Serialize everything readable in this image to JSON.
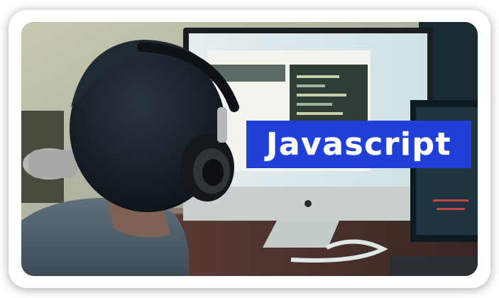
{
  "banner": {
    "text": "Javascript",
    "background_color": "#1f3fd6",
    "text_color": "#ffffff"
  },
  "photo": {
    "subject": "person-with-headphones-at-computer"
  }
}
